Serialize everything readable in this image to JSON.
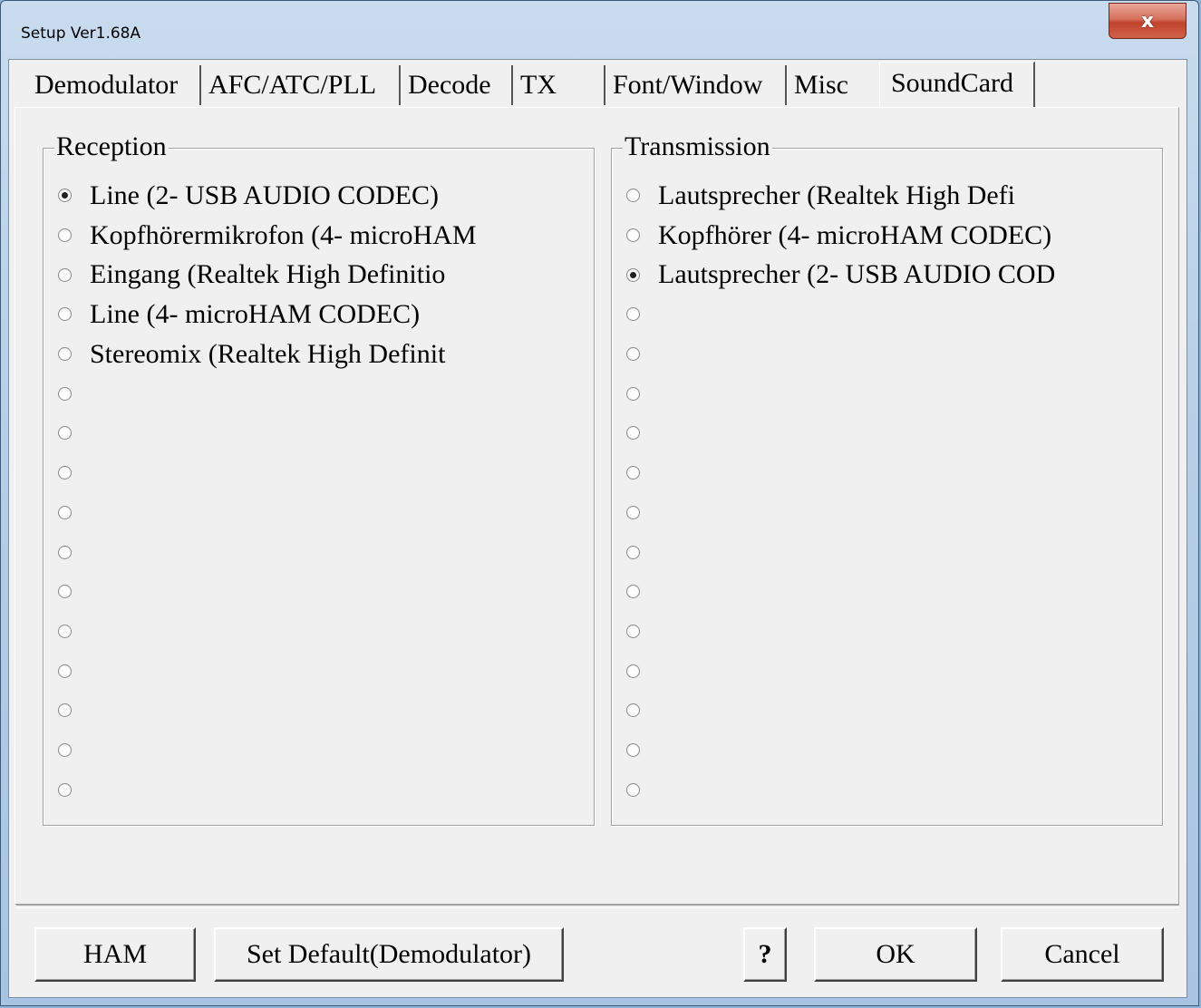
{
  "window": {
    "title": "Setup Ver1.68A",
    "close_label": "x"
  },
  "tabs": [
    {
      "label": "Demodulator",
      "active": false
    },
    {
      "label": "AFC/ATC/PLL",
      "active": false
    },
    {
      "label": "Decode",
      "active": false
    },
    {
      "label": "TX",
      "active": false
    },
    {
      "label": "Font/Window",
      "active": false
    },
    {
      "label": "Misc",
      "active": false
    },
    {
      "label": "SoundCard",
      "active": true
    }
  ],
  "reception": {
    "title": "Reception",
    "options": [
      {
        "label": "Line (2- USB AUDIO  CODEC)",
        "selected": true
      },
      {
        "label": "Kopfhörermikrofon (4- microHAM",
        "selected": false
      },
      {
        "label": "Eingang (Realtek High Definitio",
        "selected": false
      },
      {
        "label": "Line (4- microHAM CODEC)",
        "selected": false
      },
      {
        "label": "Stereomix (Realtek High Definit",
        "selected": false
      },
      {
        "label": "",
        "selected": false
      },
      {
        "label": "",
        "selected": false
      },
      {
        "label": "",
        "selected": false
      },
      {
        "label": "",
        "selected": false
      },
      {
        "label": "",
        "selected": false
      },
      {
        "label": "",
        "selected": false
      },
      {
        "label": "",
        "selected": false
      },
      {
        "label": "",
        "selected": false
      },
      {
        "label": "",
        "selected": false
      },
      {
        "label": "",
        "selected": false
      },
      {
        "label": "",
        "selected": false
      }
    ]
  },
  "transmission": {
    "title": "Transmission",
    "options": [
      {
        "label": "Lautsprecher (Realtek High Defi",
        "selected": false
      },
      {
        "label": "Kopfhörer (4- microHAM CODEC)",
        "selected": false
      },
      {
        "label": "Lautsprecher (2- USB AUDIO  COD",
        "selected": true
      },
      {
        "label": "",
        "selected": false
      },
      {
        "label": "",
        "selected": false
      },
      {
        "label": "",
        "selected": false
      },
      {
        "label": "",
        "selected": false
      },
      {
        "label": "",
        "selected": false
      },
      {
        "label": "",
        "selected": false
      },
      {
        "label": "",
        "selected": false
      },
      {
        "label": "",
        "selected": false
      },
      {
        "label": "",
        "selected": false
      },
      {
        "label": "",
        "selected": false
      },
      {
        "label": "",
        "selected": false
      },
      {
        "label": "",
        "selected": false
      },
      {
        "label": "",
        "selected": false
      }
    ]
  },
  "buttons": {
    "ham": "HAM",
    "set_default": "Set Default(Demodulator)",
    "help": "?",
    "ok": "OK",
    "cancel": "Cancel"
  }
}
